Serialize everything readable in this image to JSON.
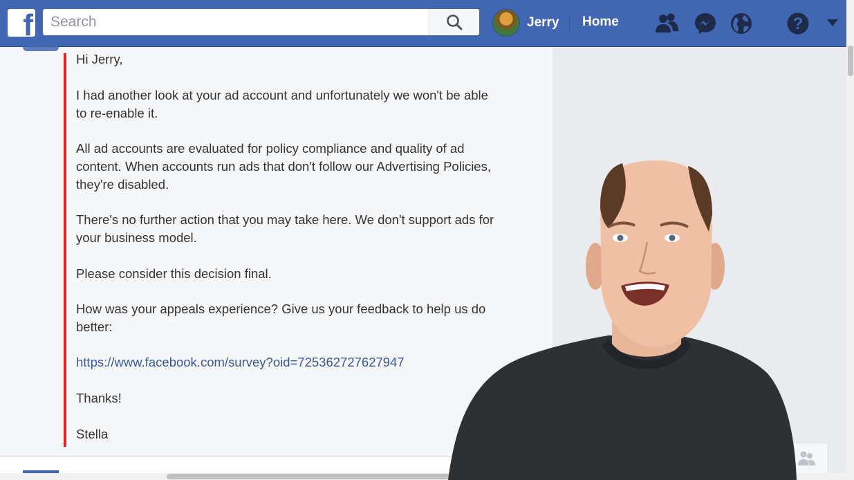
{
  "topbar": {
    "logo_letter": "f",
    "search_placeholder": "Search",
    "profile_name": "Jerry",
    "home_label": "Home",
    "brand_color": "#4267b2",
    "icons": [
      "friends-icon",
      "messenger-icon",
      "notifications-globe-icon",
      "help-icon",
      "dropdown-arrow-icon"
    ]
  },
  "message": {
    "greeting": "Hi Jerry,",
    "paragraph_1": "I had another look at your ad account and unfortunately we won't be able\nto re-enable it.",
    "paragraph_2": "All ad accounts are evaluated for policy compliance and quality of ad\ncontent. When accounts run ads that don't follow our Advertising Policies,\nthey're disabled.",
    "paragraph_3": "There's no further action that you may take here. We don't support ads for\nyour business model.",
    "paragraph_4": "Please consider this decision final.",
    "paragraph_5": "How was your appeals experience? Give us your feedback to help us do\nbetter:",
    "survey_link": "https://www.facebook.com/survey?oid=725362727627947",
    "thanks": "Thanks!",
    "signature": "Stella",
    "accent_color": "#e0241b"
  }
}
